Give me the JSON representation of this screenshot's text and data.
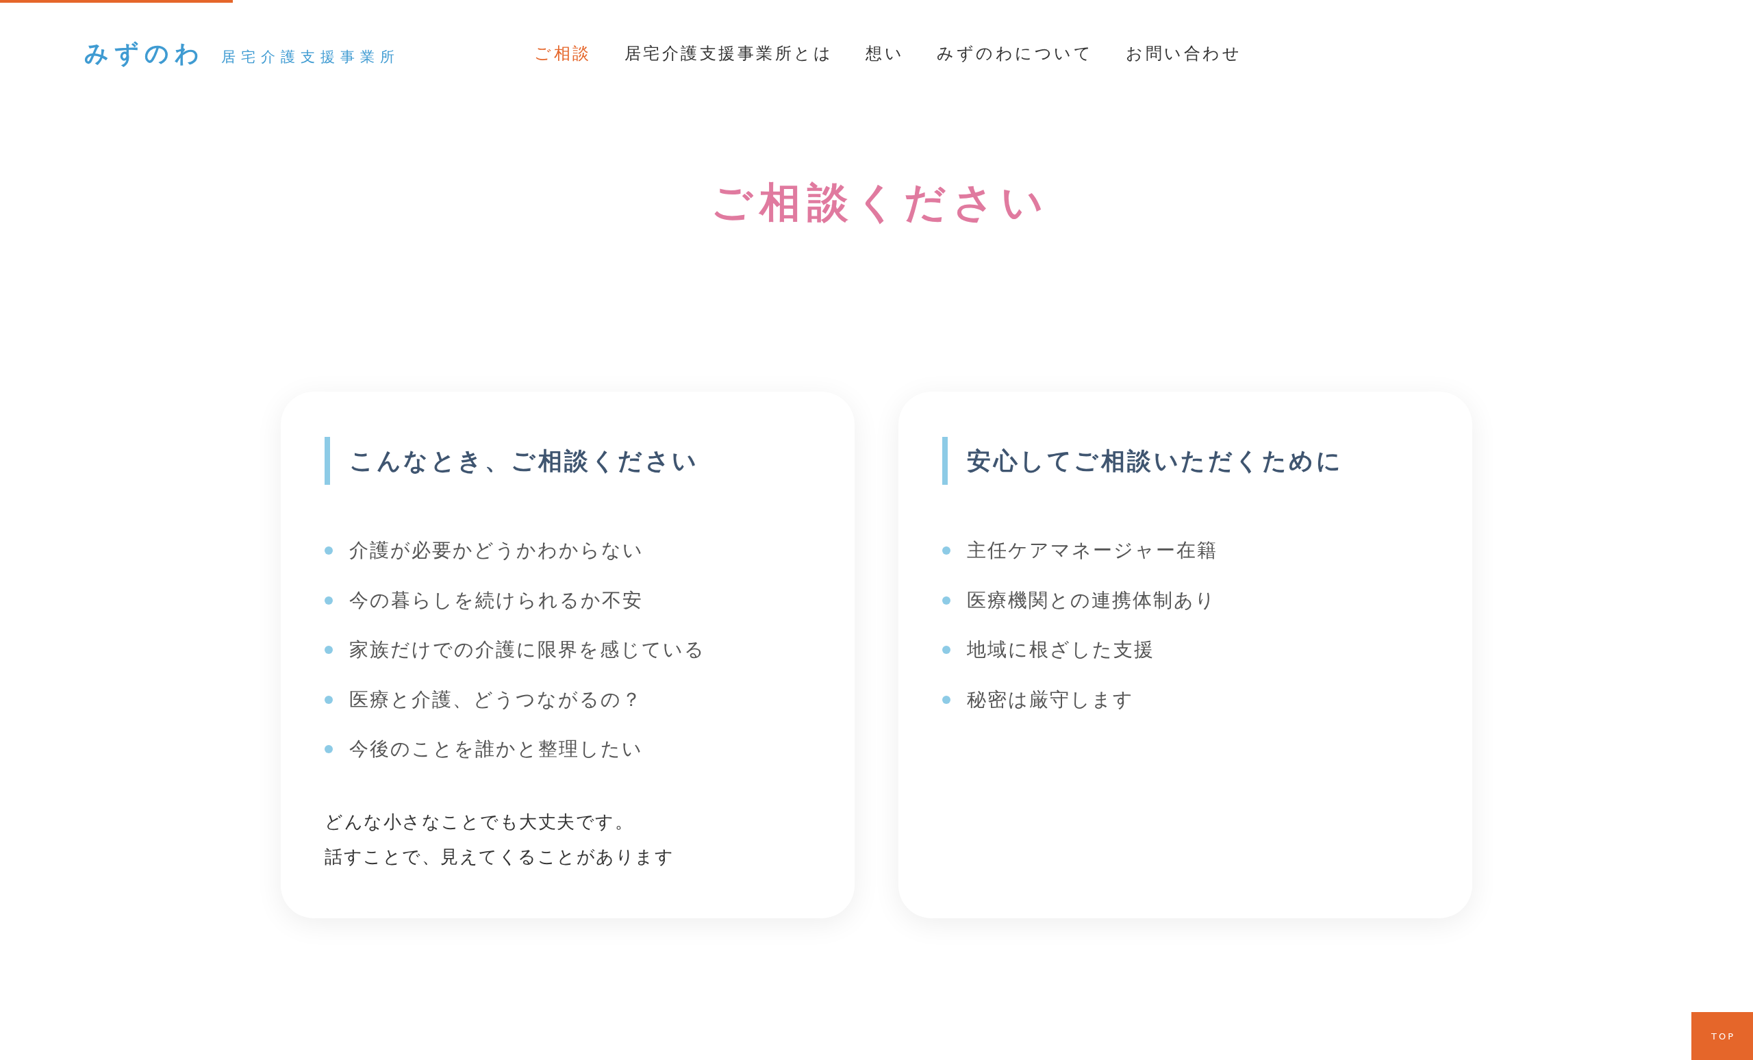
{
  "progress": {
    "level": 0.133
  },
  "header": {
    "logo": {
      "name": "みずのわ",
      "subtitle": "居宅介護支援事業所"
    },
    "nav": [
      {
        "label": "ご相談",
        "selected": true
      },
      {
        "label": "居宅介護支援事業所とは",
        "selected": false
      },
      {
        "label": "想い",
        "selected": false
      },
      {
        "label": "みずのわについて",
        "selected": false
      },
      {
        "label": "お問い合わせ",
        "selected": false
      }
    ]
  },
  "page_title": "ご相談ください",
  "cards": [
    {
      "heading": "こんなとき、ご相談ください",
      "items": [
        "介護が必要かどうかわからない",
        "今の暮らしを続けられるか不安",
        "家族だけでの介護に限界を感じている",
        "医療と介護、どうつながるの？",
        "今後のことを誰かと整理したい"
      ],
      "closing_lines": [
        "どんな小さなことでも大丈夫です。",
        "話すことで、見えてくることがあります"
      ]
    },
    {
      "heading": "安心してご相談いただくために",
      "items": [
        "主任ケアマネージャー在籍",
        "医療機関との連携体制あり",
        "地域に根ざした支援",
        "秘密は厳守します"
      ]
    }
  ],
  "top_button": {
    "label": "TOP"
  }
}
